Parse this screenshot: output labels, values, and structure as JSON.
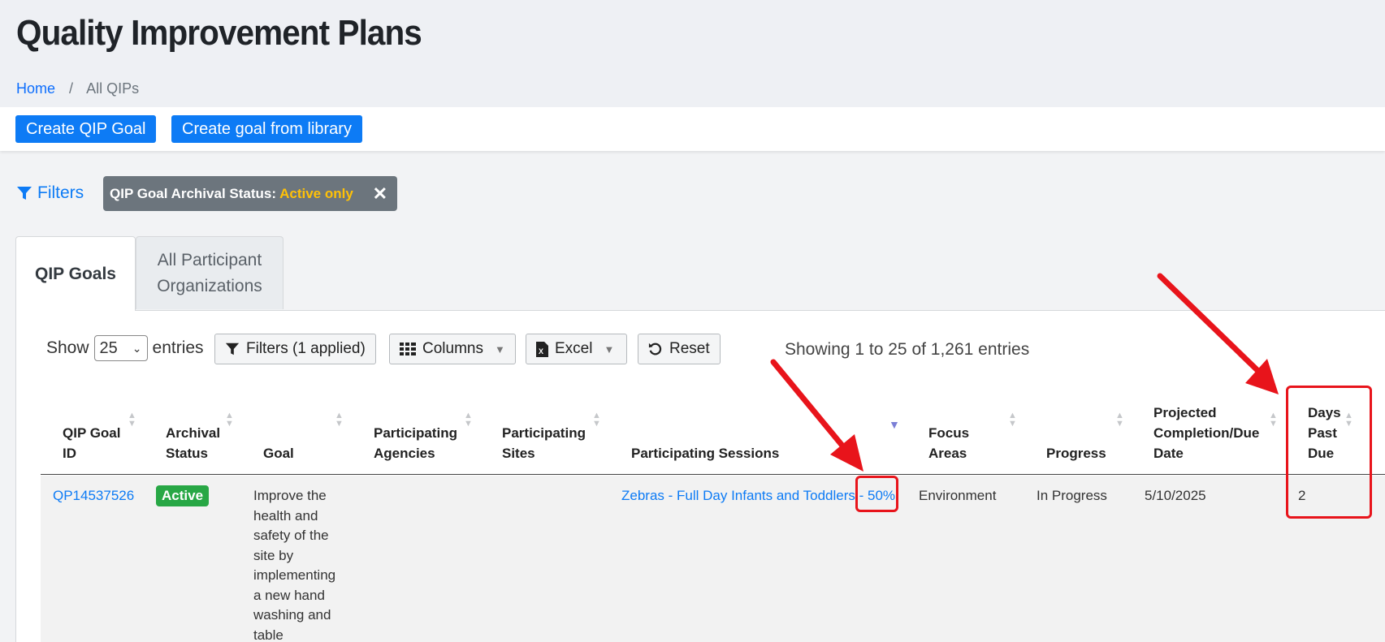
{
  "page": {
    "title": "Quality Improvement Plans"
  },
  "breadcrumb": {
    "home": "Home",
    "separator": "/",
    "current": "All QIPs"
  },
  "toolbar": {
    "create_goal": "Create QIP Goal",
    "create_from_library": "Create goal from library"
  },
  "filters": {
    "link_label": "Filters",
    "chip_label": "QIP Goal Archival Status:",
    "chip_value": "Active only",
    "chip_remove": "✕"
  },
  "tabs": [
    {
      "label": "QIP Goals",
      "active": true
    },
    {
      "label_line1": "All Participant",
      "label_line2": "Organizations",
      "active": false
    }
  ],
  "table_controls": {
    "show_label": "Show",
    "page_size": "25",
    "entries_label": "entries",
    "filters_button": "Filters (1 applied)",
    "columns_button": "Columns",
    "excel_button": "Excel",
    "reset_button": "Reset",
    "info": "Showing 1 to 25 of 1,261 entries"
  },
  "table": {
    "columns": [
      {
        "l1": "QIP Goal",
        "l2": "ID"
      },
      {
        "l1": "Archival",
        "l2": "Status"
      },
      {
        "l1": "Goal"
      },
      {
        "l1": "Participating",
        "l2": "Agencies"
      },
      {
        "l1": "Participating",
        "l2": "Sites"
      },
      {
        "l1": "Participating Sessions"
      },
      {
        "l1": "Focus",
        "l2": "Areas"
      },
      {
        "l1": "Progress"
      },
      {
        "l1": "Projected",
        "l2": "Completion/Due",
        "l3": "Date"
      },
      {
        "l1": "Days",
        "l2": "Past",
        "l3": "Due"
      }
    ],
    "rows": [
      {
        "id": "QP14537526",
        "status": "Active",
        "goal_lines": [
          "Improve the",
          "health and",
          "safety of the",
          "site by",
          "implementing",
          "a new hand",
          "washing and",
          "table"
        ],
        "agencies": "",
        "sites": "",
        "sessions": "Zebras - Full Day Infants and Toddlers - 50%",
        "focus_areas": "Environment",
        "progress": "In Progress",
        "due_date": "5/10/2025",
        "days_past_due": "2"
      }
    ]
  },
  "colors": {
    "primary": "#0d7bf5",
    "badge_active": "#28a745",
    "chip_bg": "#6c757d",
    "chip_value": "#ffc107",
    "annotation": "#e8141b"
  }
}
